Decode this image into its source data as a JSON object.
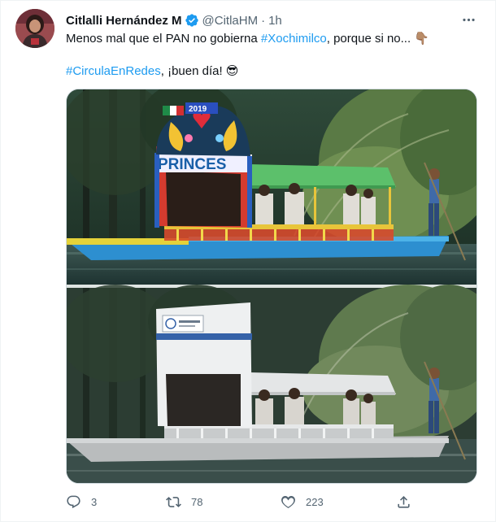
{
  "author": {
    "name": "Citlalli Hernández M",
    "handle": "@CitlaHM",
    "separator": "·",
    "time": "1h"
  },
  "tweet": {
    "text_line1_before": "Menos mal que el PAN no gobierna ",
    "hashtag1": "#Xochimilco",
    "text_line1_after": ", porque si no... 👇🏽",
    "hashtag2": "#CirculaEnRedes",
    "text_line2_after": ", ¡buen día! 😎"
  },
  "media": {
    "top_boat_sign": "2019",
    "top_boat_name": "PRINCES"
  },
  "stats": {
    "replies": "3",
    "retweets": "78",
    "likes": "223"
  },
  "icons": {
    "verified": "verified-badge-icon",
    "more": "more-icon",
    "reply": "reply-icon",
    "retweet": "retweet-icon",
    "like": "heart-icon",
    "share": "share-icon"
  },
  "colors": {
    "link": "#1d9bf0",
    "text": "#0f1419",
    "muted": "#536471",
    "verified": "#1d9bf0"
  }
}
